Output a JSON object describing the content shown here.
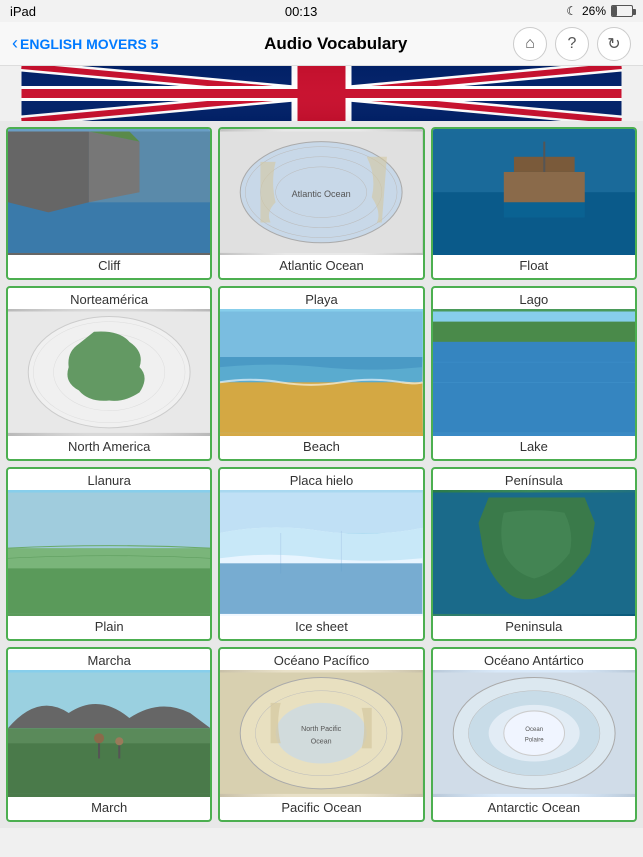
{
  "statusBar": {
    "device": "iPad",
    "time": "00:13",
    "battery": "26%",
    "moonIcon": "☾"
  },
  "navBar": {
    "backLabel": "ENGLISH MOVERS 5",
    "title": "Audio Vocabulary",
    "homeIcon": "⌂",
    "helpIcon": "?",
    "refreshIcon": "↻"
  },
  "cards": [
    {
      "id": "cliff",
      "labelTop": "Cliff",
      "labelBottom": "Cliff",
      "imgClass": "img-cliff",
      "hasTopLabel": false
    },
    {
      "id": "atlantic-ocean",
      "labelTop": "Atlantic Ocean",
      "labelBottom": "Atlantic Ocean",
      "imgClass": "img-atlantic",
      "hasTopLabel": false
    },
    {
      "id": "float",
      "labelTop": "Float",
      "labelBottom": "Float",
      "imgClass": "img-float",
      "hasTopLabel": false
    },
    {
      "id": "north-america",
      "labelTop": "Norteamérica",
      "labelBottom": "North America",
      "imgClass": "img-north-america",
      "hasTopLabel": true
    },
    {
      "id": "beach",
      "labelTop": "Playa",
      "labelBottom": "Beach",
      "imgClass": "img-beach",
      "hasTopLabel": true
    },
    {
      "id": "lake",
      "labelTop": "Lago",
      "labelBottom": "Lake",
      "imgClass": "img-lake",
      "hasTopLabel": true
    },
    {
      "id": "plain",
      "labelTop": "Llanura",
      "labelBottom": "Plain",
      "imgClass": "img-plain",
      "hasTopLabel": true
    },
    {
      "id": "ice-sheet",
      "labelTop": "Placa hielo",
      "labelBottom": "Ice sheet",
      "imgClass": "img-ice",
      "hasTopLabel": true
    },
    {
      "id": "peninsula",
      "labelTop": "Península",
      "labelBottom": "Peninsula",
      "imgClass": "img-peninsula",
      "hasTopLabel": true
    },
    {
      "id": "march",
      "labelTop": "Marcha",
      "labelBottom": "March",
      "imgClass": "img-march",
      "hasTopLabel": true
    },
    {
      "id": "pacific-ocean",
      "labelTop": "Océano Pacífico",
      "labelBottom": "Pacific Ocean",
      "imgClass": "img-pacific",
      "hasTopLabel": true
    },
    {
      "id": "antarctic-ocean",
      "labelTop": "Océano Antártico",
      "labelBottom": "Antarctic Ocean",
      "imgClass": "img-antarctic",
      "hasTopLabel": true
    }
  ]
}
